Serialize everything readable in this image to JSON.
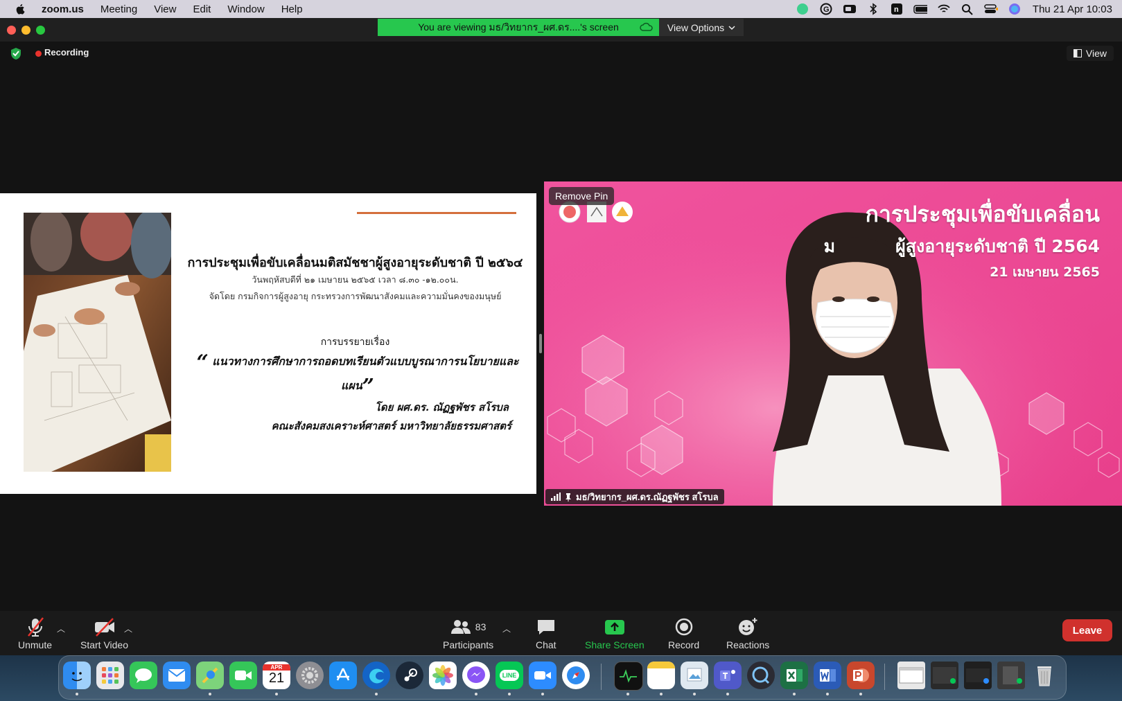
{
  "menubar": {
    "app_name": "zoom.us",
    "menus": [
      "Meeting",
      "View",
      "Edit",
      "Window",
      "Help"
    ],
    "clock": "Thu 21 Apr  10:03",
    "status_icons": [
      "grammarly-icon",
      "zoom-icon",
      "bluetooth-icon",
      "notion-icon",
      "battery-icon",
      "wifi-icon",
      "search-icon",
      "control-center-icon",
      "siri-icon"
    ]
  },
  "window": {
    "viewing_banner": "You are viewing มธ/วิทยากร_ผศ.ดร....'s screen",
    "view_options": "View Options",
    "recording_label": "Recording",
    "view_button": "View"
  },
  "slide": {
    "title": "การประชุมเพื่อขับเคลื่อนมติสมัชชาผู้สูงอายุระดับชาติ ปี ๒๕๖๔",
    "date_line": "วันพฤหัสบดีที่ ๒๑ เมษายน ๒๕๖๕ เวลา ๘.๓๐ -๑๒.๐๐น.",
    "organizer_line": "จัดโดย กรมกิจการผู้สูงอายุ กระทรวงการพัฒนาสังคมและความมั่นคงของมนุษย์",
    "lecture_label": "การบรรยายเรื่อง",
    "open_quote": "“",
    "topic": "แนวทางการศึกษาการถอดบทเรียนตัวแบบบูรณาการนโยบายและแผน",
    "close_quote": "”",
    "speaker": "โดย ผศ.ดร. ณัฏฐพัชร สโรบล",
    "faculty": "คณะสังคมสงเคราะห์ศาสตร์ มหาวิทยาลัยธรรมศาสตร์"
  },
  "video": {
    "remove_pin": "Remove Pin",
    "title_line1": "การประชุมเพื่อขับเคลื่อน",
    "title_line2_fragment": "ม          ผู้สูงอายุระดับชาติ ปี 2564",
    "date": "21 เมษายน 2565",
    "participant_name": "มธ/วิทยากร_ผศ.ดร.ณัฏฐพัชร สโรบล"
  },
  "toolbar": {
    "unmute": "Unmute",
    "start_video": "Start Video",
    "participants": "Participants",
    "participants_count": "83",
    "chat": "Chat",
    "share_screen": "Share Screen",
    "record": "Record",
    "reactions": "Reactions",
    "leave": "Leave",
    "share_color": "#27c74e",
    "leave_color": "#d0312d"
  },
  "dock": {
    "calendar_month": "APR",
    "calendar_day": "21",
    "line_label": "LINE",
    "apps": [
      "finder",
      "launchpad",
      "messages",
      "mail",
      "maps",
      "facetime",
      "calendar",
      "system-preferences",
      "app-store",
      "edge",
      "steam",
      "photos",
      "messenger",
      "line",
      "zoom",
      "safari",
      "activity-monitor",
      "notes",
      "preview",
      "teams",
      "quicktime",
      "excel",
      "word",
      "powerpoint",
      "window-1",
      "window-2",
      "window-3",
      "window-4",
      "trash"
    ]
  }
}
